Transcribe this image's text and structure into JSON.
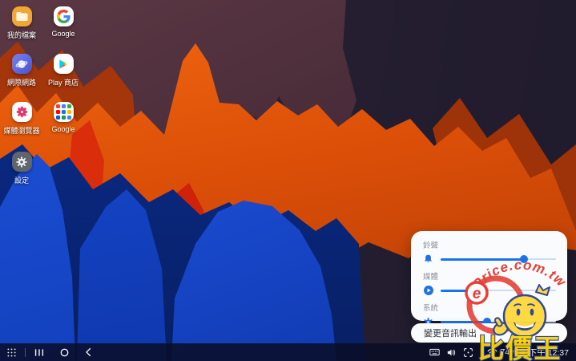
{
  "app_grid": {
    "apps": [
      {
        "label": "我的檔案",
        "icon": "my-files-icon"
      },
      {
        "label": "Google",
        "icon": "google-icon"
      },
      {
        "label": "網際網路",
        "icon": "internet-icon"
      },
      {
        "label": "Play 商店",
        "icon": "play-store-icon"
      },
      {
        "label": "媒體瀏覽器",
        "icon": "gallery-icon"
      },
      {
        "label": "Google",
        "icon": "google-folder-icon"
      },
      {
        "label": "設定",
        "icon": "settings-icon"
      }
    ]
  },
  "volume_panel": {
    "accent": "#1a73e8",
    "sliders": [
      {
        "label": "鈴聲",
        "icon": "bell-icon",
        "value": 72,
        "active": false
      },
      {
        "label": "媒體",
        "icon": "media-play-icon",
        "value": 33,
        "active": true
      },
      {
        "label": "系統",
        "icon": "system-gear-icon",
        "value": 40,
        "active": false
      }
    ]
  },
  "audio_output_bar": {
    "label": "變更音訊輸出"
  },
  "taskbar": {
    "nav": [
      "apps-grid",
      "recents",
      "home",
      "back"
    ],
    "status": {
      "battery": "74%",
      "time": "下午 12:37"
    }
  },
  "watermark": {
    "ring_letter": "e",
    "arc_text": "Price.com.tw",
    "title": "比價王"
  }
}
